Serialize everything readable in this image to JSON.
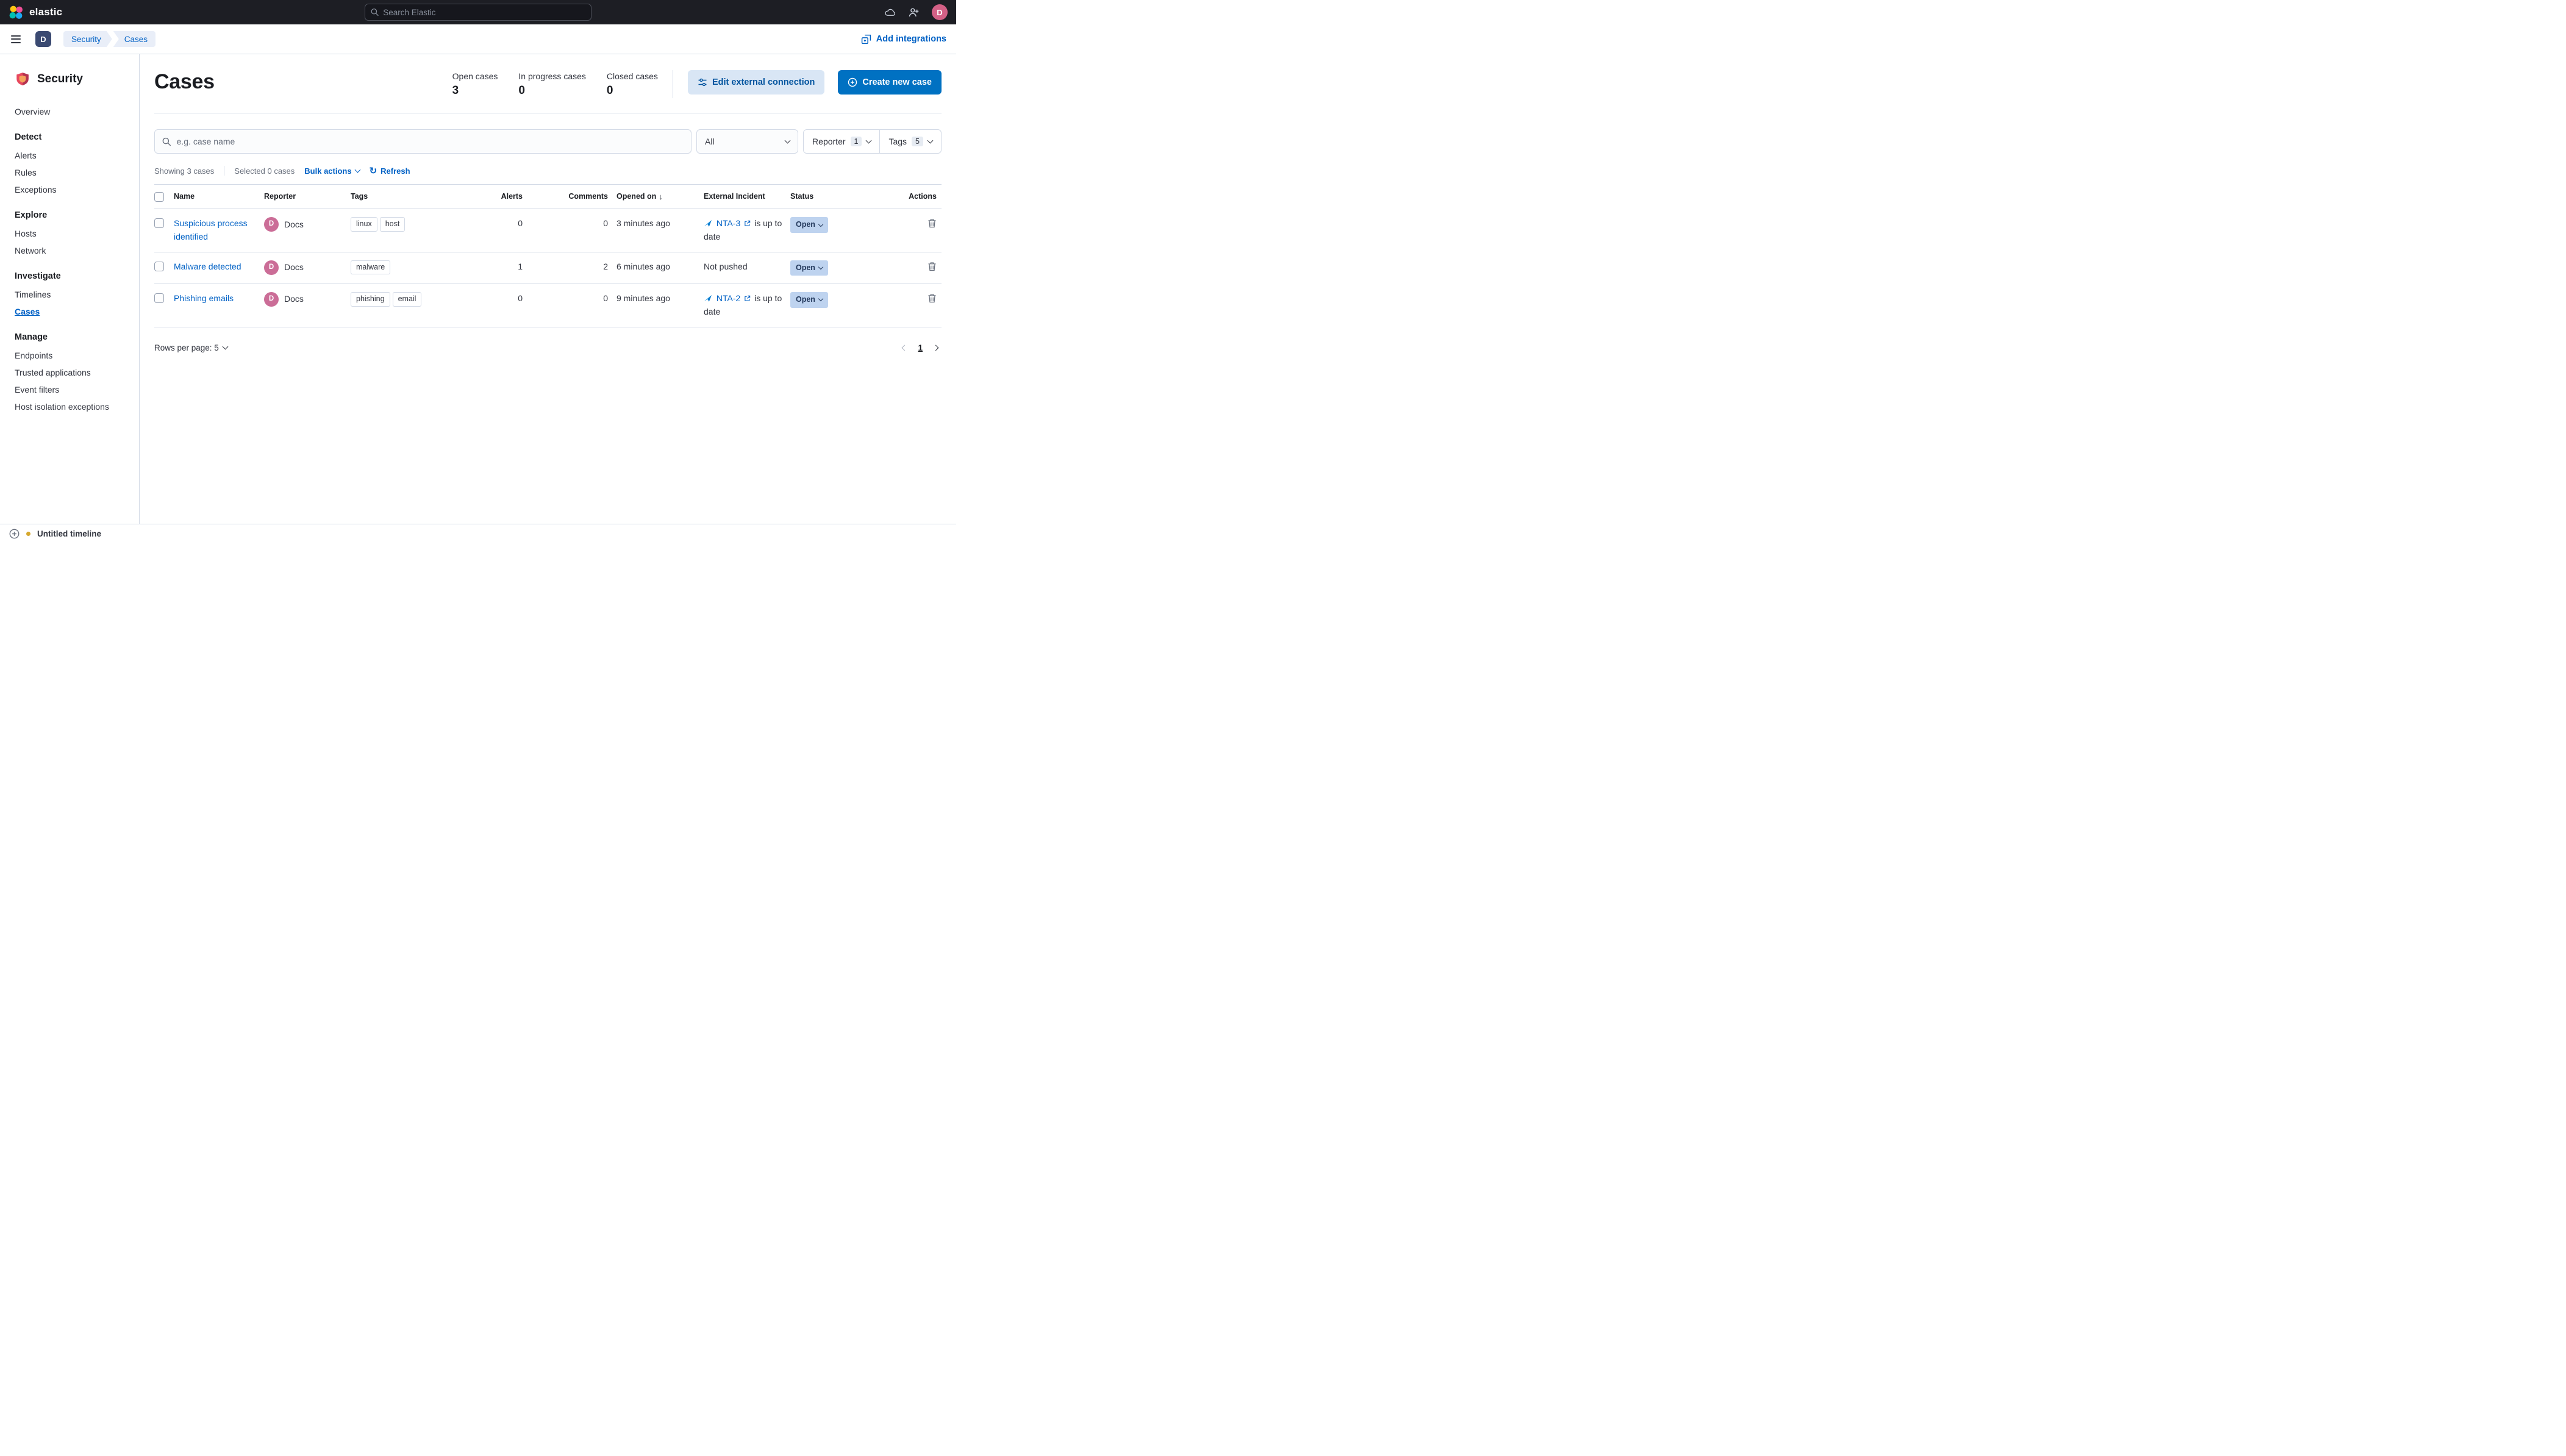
{
  "colors": {
    "accent_link": "#0061c5",
    "primary_button": "#0071c2",
    "secondary_button_bg": "#d9e6f5",
    "status_badge_bg": "#bed3ef",
    "header_dark": "#1d1e24",
    "avatar_pink": "#d36086"
  },
  "header": {
    "brand": "elastic",
    "search_placeholder": "Search Elastic",
    "avatar_initial": "D"
  },
  "breadcrumb_bar": {
    "space_initial": "D",
    "crumbs": [
      "Security",
      "Cases"
    ],
    "add_integrations": "Add integrations"
  },
  "sidebar": {
    "title": "Security",
    "sections": [
      {
        "header": null,
        "items": [
          {
            "label": "Overview"
          }
        ]
      },
      {
        "header": "Detect",
        "items": [
          {
            "label": "Alerts"
          },
          {
            "label": "Rules"
          },
          {
            "label": "Exceptions"
          }
        ]
      },
      {
        "header": "Explore",
        "items": [
          {
            "label": "Hosts"
          },
          {
            "label": "Network"
          }
        ]
      },
      {
        "header": "Investigate",
        "items": [
          {
            "label": "Timelines"
          },
          {
            "label": "Cases",
            "active": true
          }
        ]
      },
      {
        "header": "Manage",
        "items": [
          {
            "label": "Endpoints"
          },
          {
            "label": "Trusted applications"
          },
          {
            "label": "Event filters"
          },
          {
            "label": "Host isolation exceptions"
          }
        ]
      }
    ]
  },
  "page": {
    "title": "Cases",
    "stats": [
      {
        "label": "Open cases",
        "value": "3"
      },
      {
        "label": "In progress cases",
        "value": "0"
      },
      {
        "label": "Closed cases",
        "value": "0"
      }
    ],
    "edit_external_connection": "Edit external connection",
    "create_new_case": "Create new case"
  },
  "filters": {
    "search_placeholder": "e.g. case name",
    "solution_filter": "All",
    "reporter": {
      "label": "Reporter",
      "count": "1"
    },
    "tags": {
      "label": "Tags",
      "count": "5"
    }
  },
  "utility": {
    "showing": "Showing 3 cases",
    "selected": "Selected 0 cases",
    "bulk_actions": "Bulk actions",
    "refresh": "Refresh"
  },
  "table": {
    "columns": [
      "Name",
      "Reporter",
      "Tags",
      "Alerts",
      "Comments",
      "Opened on",
      "External Incident",
      "Status",
      "Actions"
    ],
    "rows": [
      {
        "name": "Suspicious process identified",
        "avatar_initial": "D",
        "reporter": "Docs",
        "tags": [
          "linux",
          "host"
        ],
        "alerts": "0",
        "comments": "0",
        "opened": "3 minutes ago",
        "incident": {
          "ref": "NTA-3",
          "suffix": "is up to date"
        },
        "status": "Open"
      },
      {
        "name": "Malware detected",
        "avatar_initial": "D",
        "reporter": "Docs",
        "tags": [
          "malware"
        ],
        "alerts": "1",
        "comments": "2",
        "opened": "6 minutes ago",
        "incident": {
          "text": "Not pushed"
        },
        "status": "Open"
      },
      {
        "name": "Phishing emails",
        "avatar_initial": "D",
        "reporter": "Docs",
        "tags": [
          "phishing",
          "email"
        ],
        "alerts": "0",
        "comments": "0",
        "opened": "9 minutes ago",
        "incident": {
          "ref": "NTA-2",
          "suffix": "is up to date"
        },
        "status": "Open"
      }
    ],
    "rows_per_page": "Rows per page: 5",
    "page_number": "1"
  },
  "timeline_bar": {
    "label": "Untitled timeline"
  }
}
